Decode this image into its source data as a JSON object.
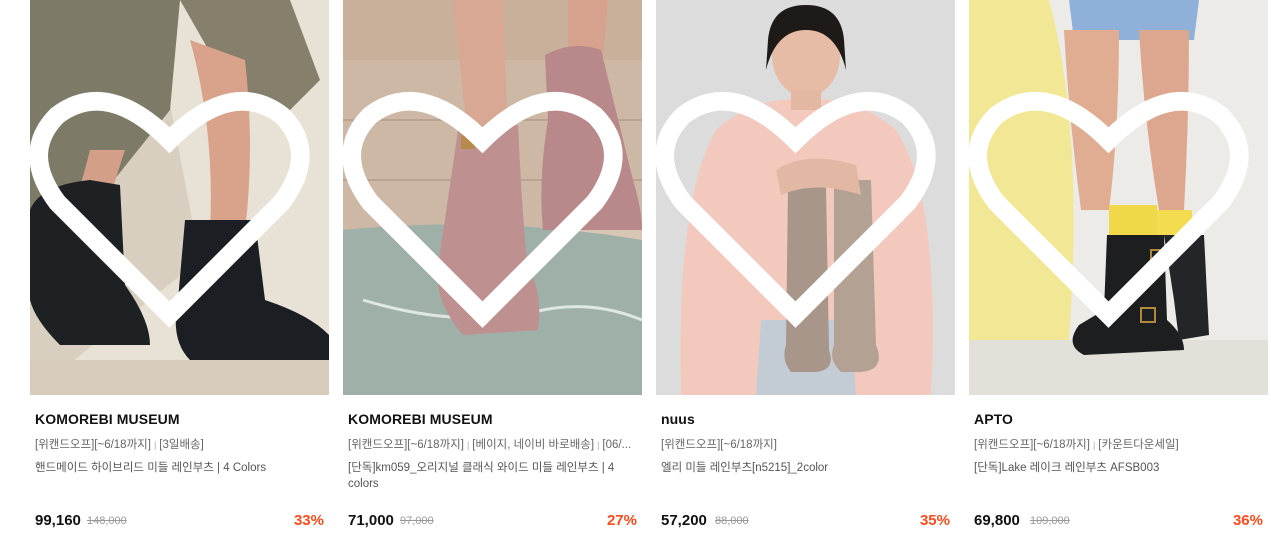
{
  "products": [
    {
      "brand": "KOMOREBI MUSEUM",
      "tags": [
        "[위캔드오프][~6/18까지]",
        "[3일배송]"
      ],
      "name": "핸드메이드 하이브리드 미들 레인부츠 | 4 Colors",
      "price": "99,160",
      "original_price": "148,000",
      "discount": "33%",
      "wishlist_icon": "heart-outline-icon"
    },
    {
      "brand": "KOMOREBI MUSEUM",
      "tags": [
        "[위캔드오프][~6/18까지]",
        "[베이지, 네이비 바로배송]",
        "[06/..."
      ],
      "name": "[단독]km059_오리지널 클래식 와이드 미들 레인부츠 | 4 colors",
      "price": "71,000",
      "original_price": "97,000",
      "discount": "27%",
      "wishlist_icon": "heart-outline-icon"
    },
    {
      "brand": "nuus",
      "tags": [
        "[위캔드오프][~6/18까지]"
      ],
      "name": "엘리 미들 레인부츠[n5215]_2color",
      "price": "57,200",
      "original_price": "88,000",
      "discount": "35%",
      "wishlist_icon": "heart-outline-icon"
    },
    {
      "brand": "APTO",
      "tags": [
        "[위캔드오프][~6/18까지]",
        "[카운트다운세일]"
      ],
      "name": "[단독]Lake 레이크 레인부츠 AFSB003",
      "price": "69,800",
      "original_price": "109,000",
      "discount": "36%",
      "wishlist_icon": "heart-outline-icon"
    }
  ],
  "colors": {
    "discount": "#ff4a1a",
    "brand_text": "#111111",
    "tag_text": "#666666"
  }
}
